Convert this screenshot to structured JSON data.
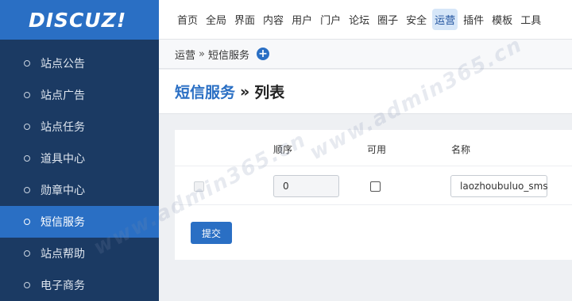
{
  "logo": "DISCUZ!",
  "sidebar": {
    "items": [
      {
        "label": "站点公告",
        "active": false
      },
      {
        "label": "站点广告",
        "active": false
      },
      {
        "label": "站点任务",
        "active": false
      },
      {
        "label": "道具中心",
        "active": false
      },
      {
        "label": "勋章中心",
        "active": false
      },
      {
        "label": "短信服务",
        "active": true
      },
      {
        "label": "站点帮助",
        "active": false
      },
      {
        "label": "电子商务",
        "active": false
      }
    ]
  },
  "topnav": {
    "items": [
      "首页",
      "全局",
      "界面",
      "内容",
      "用户",
      "门户",
      "论坛",
      "圈子",
      "安全",
      "运营",
      "插件",
      "模板",
      "工具"
    ],
    "active": "运营"
  },
  "breadcrumb": {
    "parent": "运营",
    "separator": "»",
    "current": "短信服务"
  },
  "page_title": {
    "section": "短信服务",
    "separator": "»",
    "sub": "列表"
  },
  "table": {
    "headers": {
      "order": "顺序",
      "enabled": "可用",
      "name": "名称"
    },
    "rows": [
      {
        "order_value": "0",
        "enabled": false,
        "name_value": "laozhoubuluo_sms"
      }
    ]
  },
  "submit_label": "提交",
  "watermarks": [
    "www.admin365.cn",
    "www.admin365.cn"
  ],
  "colors": {
    "sidebar": "#1b3a63",
    "accent": "#2a6fc4",
    "active_top": "#d6e6f8"
  }
}
